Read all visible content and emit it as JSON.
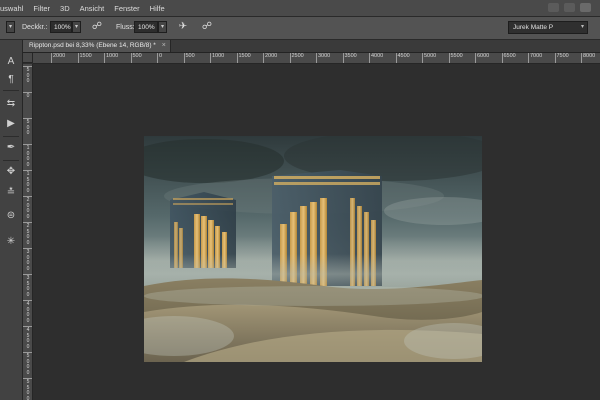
{
  "menubar": {
    "items": [
      "uswahl",
      "Filter",
      "3D",
      "Ansicht",
      "Fenster",
      "Hilfe"
    ]
  },
  "options": {
    "deckkraft_label": "Deckkr.:",
    "deckkraft_value": "100%",
    "fluss_label": "Fluss:",
    "fluss_value": "100%",
    "workspace": "Jurek Matte P"
  },
  "document": {
    "tab_label": "Rippton.psd bei 8,33% (Ebene 14, RGB/8) *",
    "tab_close": "×"
  },
  "ruler": {
    "h_ticks": [
      "2000",
      "1500",
      "1000",
      "500",
      "0",
      "500",
      "1000",
      "1500",
      "2000",
      "2500",
      "3000",
      "3500",
      "4000",
      "4500",
      "5000",
      "5500",
      "6000",
      "6500",
      "7000",
      "7500",
      "8000"
    ],
    "v_ticks": [
      [
        "5",
        "0",
        "0"
      ],
      [
        "0"
      ],
      [
        "5",
        "0",
        "0"
      ],
      [
        "1",
        "0",
        "0",
        "0"
      ],
      [
        "1",
        "5",
        "0",
        "0"
      ],
      [
        "2",
        "0",
        "0",
        "0"
      ],
      [
        "2",
        "5",
        "0",
        "0"
      ],
      [
        "3",
        "0",
        "0",
        "0"
      ],
      [
        "3",
        "5",
        "0",
        "0"
      ],
      [
        "4",
        "0",
        "0",
        "0"
      ],
      [
        "4",
        "5",
        "0",
        "0"
      ],
      [
        "5",
        "0",
        "0",
        "0"
      ],
      [
        "5",
        "5",
        "0",
        "0"
      ]
    ]
  },
  "toolbar": {
    "tools": [
      "text-icon",
      "paragraph-icon",
      "transform-icon",
      "play-icon",
      "pen-icon",
      "paint-icon",
      "adjust-icon",
      "layers-icon",
      "settings-icon"
    ]
  }
}
